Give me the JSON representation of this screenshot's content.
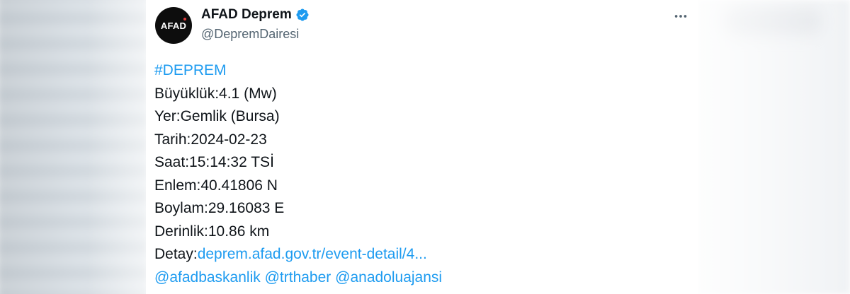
{
  "tweet": {
    "display_name": "AFAD Deprem",
    "handle": "@DepremDairesi",
    "avatar_text": "AFAD",
    "hashtag": "#DEPREM",
    "lines": {
      "magnitude": "Büyüklük:4.1 (Mw)",
      "location": "Yer:Gemlik (Bursa)",
      "date": "Tarih:2024-02-23",
      "time": "Saat:15:14:32 TSİ",
      "latitude": "Enlem:40.41806 N",
      "longitude": "Boylam:29.16083 E",
      "depth": "Derinlik:10.86 km"
    },
    "detail_label": "Detay:",
    "detail_link": "deprem.afad.gov.tr/event-detail/4...",
    "mentions": [
      "@afadbaskanlik",
      "@trthaber",
      "@anadoluajansi"
    ]
  },
  "colors": {
    "accent": "#1d9bf0",
    "text": "#0f1419",
    "muted": "#536471"
  },
  "icons": {
    "verified": "verified-badge-icon",
    "more": "more-options-icon"
  }
}
